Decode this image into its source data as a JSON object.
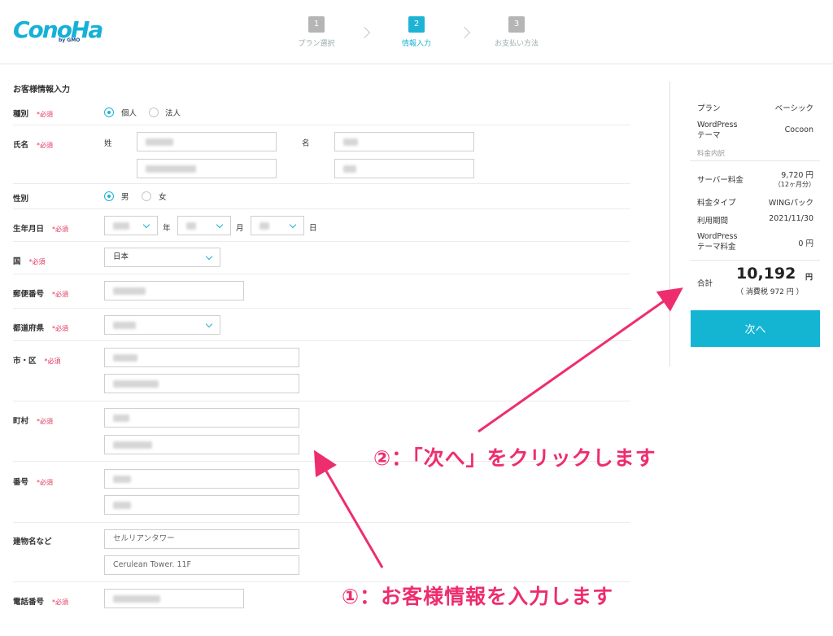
{
  "header": {
    "logo": "ConoHa",
    "logo_sub": "by GMO",
    "steps": [
      {
        "num": "1",
        "label": "プラン選択"
      },
      {
        "num": "2",
        "label": "情報入力"
      },
      {
        "num": "3",
        "label": "お支払い方法"
      }
    ]
  },
  "form": {
    "title": "お客様情報入力",
    "required_mark": "*必須",
    "type": {
      "label": "種別",
      "options": [
        "個人",
        "法人"
      ],
      "selected": "個人"
    },
    "name": {
      "label": "氏名",
      "last_label": "姓",
      "first_label": "名"
    },
    "gender": {
      "label": "性別",
      "options": [
        "男",
        "女"
      ],
      "selected": "男"
    },
    "birthdate": {
      "label": "生年月日",
      "year_unit": "年",
      "month_unit": "月",
      "day_unit": "日"
    },
    "country": {
      "label": "国",
      "value": "日本"
    },
    "postal": {
      "label": "郵便番号"
    },
    "prefecture": {
      "label": "都道府県"
    },
    "city": {
      "label": "市・区"
    },
    "town": {
      "label": "町村"
    },
    "number": {
      "label": "番号"
    },
    "building": {
      "label": "建物名など",
      "value1": "セルリアンタワー",
      "value2": "Cerulean Tower. 11F"
    },
    "phone": {
      "label": "電話番号"
    }
  },
  "summary": {
    "plan_label": "プラン",
    "plan_value": "ベーシック",
    "theme_label": "WordPress\nテーマ",
    "theme_value": "Cocoon",
    "breakdown_label": "料金内訳",
    "server_fee_label": "サーバー料金",
    "server_fee_value": "9,720 円",
    "server_fee_note": "（12ヶ月分）",
    "fee_type_label": "料金タイプ",
    "fee_type_value": "WINGパック",
    "period_label": "利用期間",
    "period_value": "2021/11/30",
    "theme_fee_label": "WordPress\nテーマ料金",
    "theme_fee_value": "0 円",
    "total_label": "合計",
    "total_value": "10,192",
    "total_unit": "円",
    "tax_note": "（ 消費税 972 円 ）",
    "next_button": "次へ"
  },
  "annotations": {
    "step1": "①：お客様情報を入力します",
    "step2": "②：「次へ」をクリックします"
  }
}
